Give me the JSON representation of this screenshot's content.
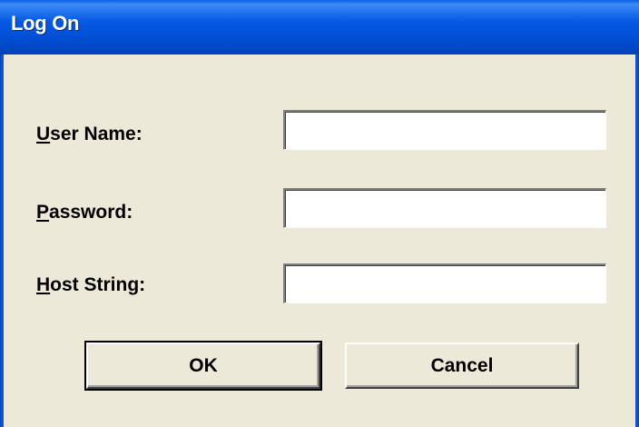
{
  "window": {
    "title": "Log On"
  },
  "form": {
    "username": {
      "accel": "U",
      "label_rest": "ser Name:",
      "value": ""
    },
    "password": {
      "accel": "P",
      "label_rest": "assword:",
      "value": ""
    },
    "host": {
      "accel": "H",
      "label_rest": "ost String:",
      "value": ""
    }
  },
  "buttons": {
    "ok_label": "OK",
    "cancel_label": "Cancel"
  },
  "colors": {
    "title_bar": "#0458E3",
    "dialog_bg": "#ECE9D8",
    "field_bg": "#FFFFFF"
  }
}
